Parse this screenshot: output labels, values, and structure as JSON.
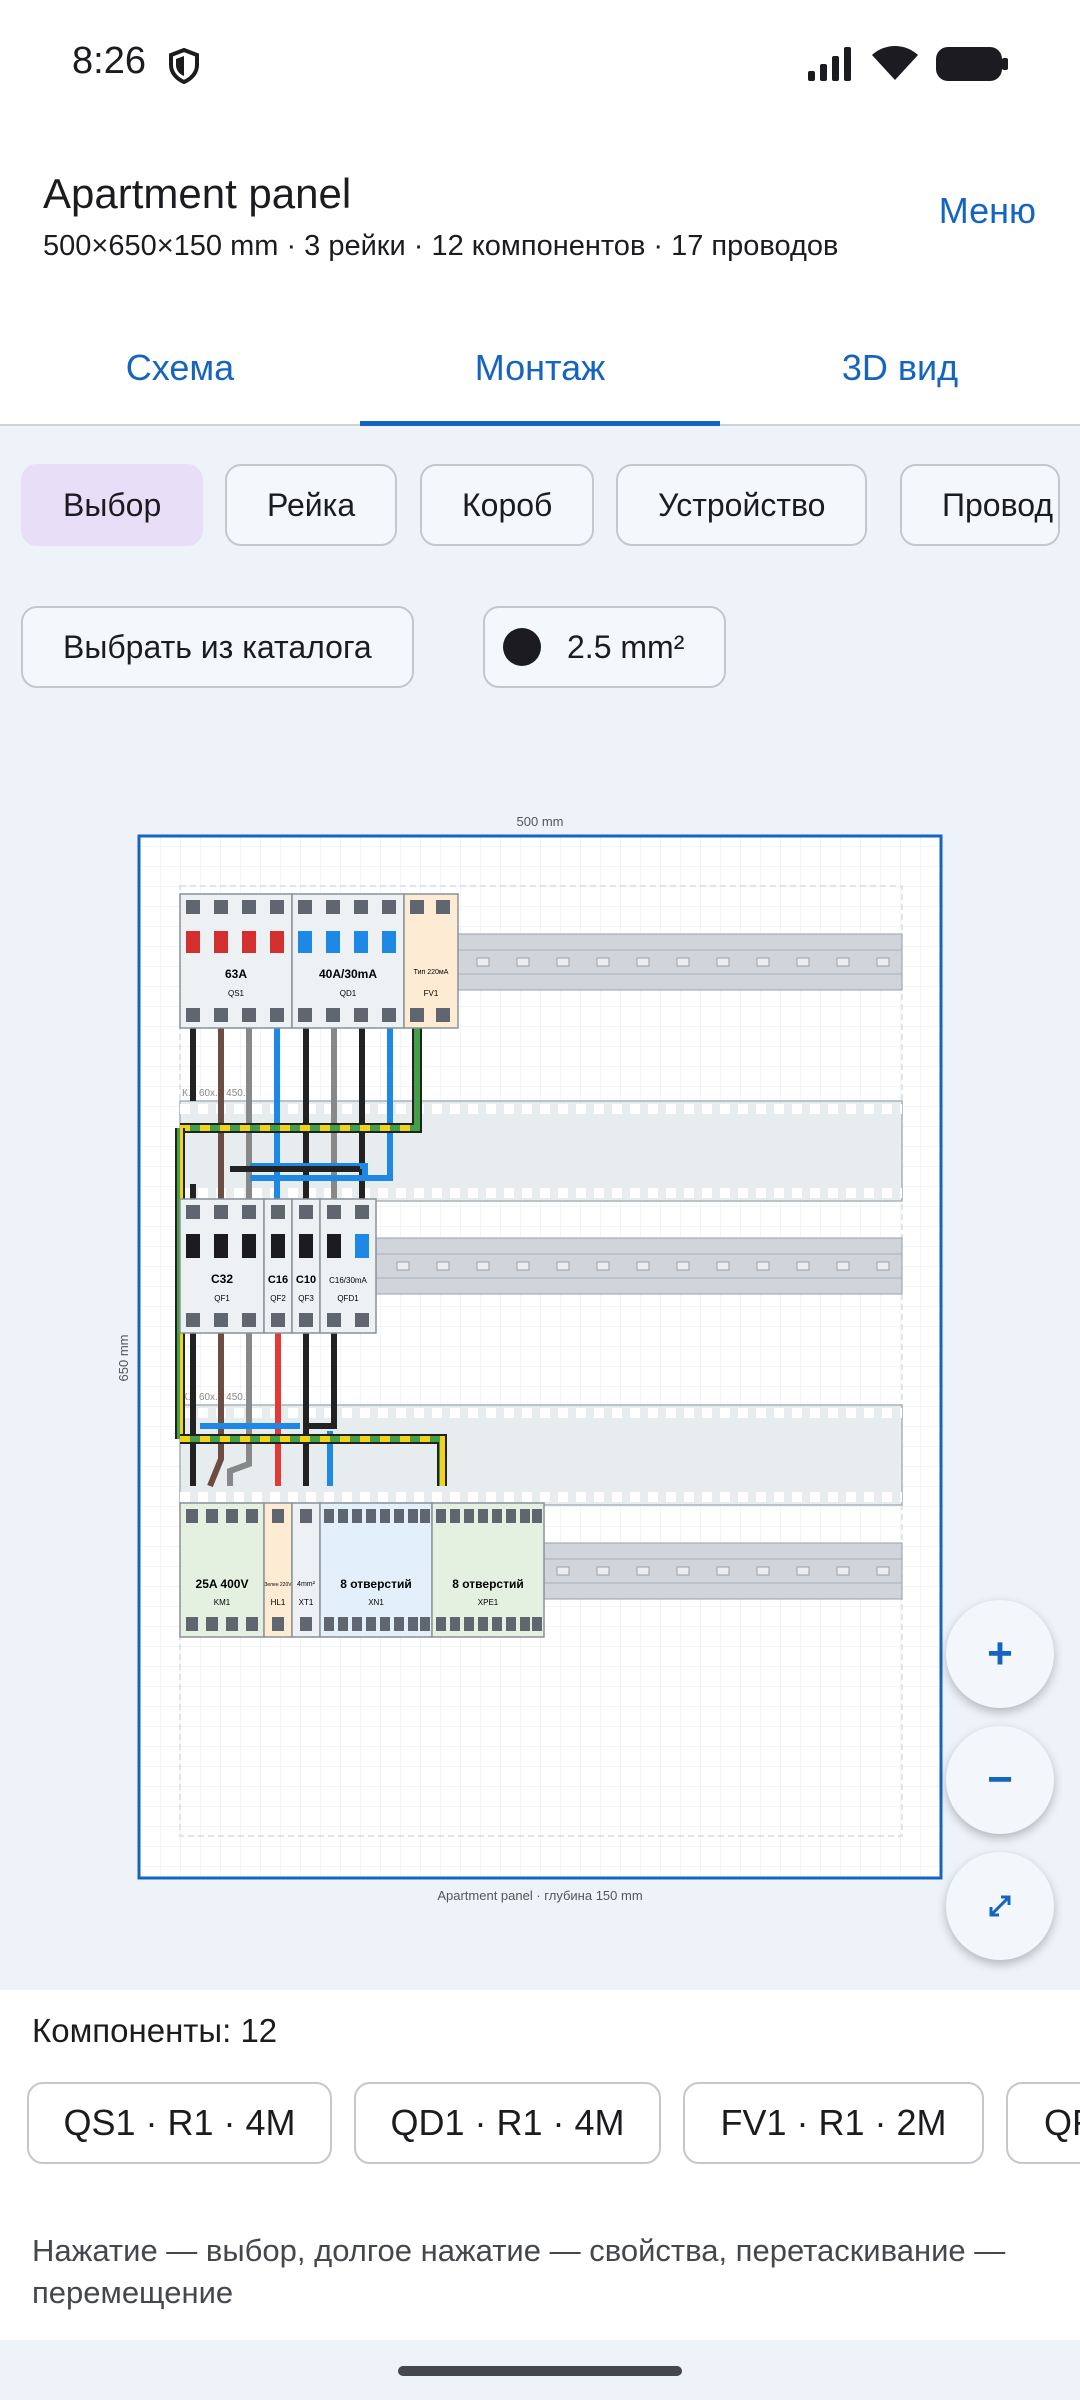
{
  "status": {
    "time": "8:26"
  },
  "header": {
    "title": "Apartment panel",
    "subtitle": "500×650×150 mm · 3 рейки · 12 компонентов · 17 проводов",
    "menu_label": "Меню"
  },
  "tabs": [
    {
      "label": "Схема",
      "active": false
    },
    {
      "label": "Монтаж",
      "active": true
    },
    {
      "label": "3D вид",
      "active": false
    }
  ],
  "tools": {
    "modes": [
      "Выбор",
      "Рейка",
      "Короб",
      "Устройство",
      "Провод"
    ],
    "selected_mode": "Выбор",
    "catalog_label": "Выбрать из каталога",
    "wire_size_label": "2.5 mm²"
  },
  "drawing": {
    "width_label": "500 mm",
    "height_label": "650 mm",
    "caption": "Apartment panel · глубина 150 mm",
    "duct_label": "К... 60х... 450...",
    "devices": [
      {
        "id": "QS1",
        "rating": "63A"
      },
      {
        "id": "QD1",
        "rating": "40A/30mA"
      },
      {
        "id": "FV1",
        "rating": "Тип 220мА"
      },
      {
        "id": "QF1",
        "rating": "C32"
      },
      {
        "id": "QF2",
        "rating": "C16"
      },
      {
        "id": "QF3",
        "rating": "C10"
      },
      {
        "id": "QFD1",
        "rating": "C16/30mA"
      },
      {
        "id": "KM1",
        "rating": "25A 400V"
      },
      {
        "id": "HL1",
        "rating": "Зелен 220V"
      },
      {
        "id": "XT1",
        "rating": "4mm²"
      },
      {
        "id": "XN1",
        "rating": "8 отверстий"
      },
      {
        "id": "XPE1",
        "rating": "8 отверстий"
      }
    ]
  },
  "zoom": {
    "in_label": "+",
    "out_label": "−"
  },
  "components": {
    "count_label": "Компоненты: 12",
    "chips": [
      "QS1 · R1 · 4M",
      "QD1 · R1 · 4M",
      "FV1 · R1 · 2M",
      "QF"
    ]
  },
  "hint": "Нажатие — выбор, долгое нажатие — свойства, перетаскивание — перемещение",
  "colors": {
    "accent": "#1565c0",
    "selected_chip": "#e8def8",
    "canvas_bg": "#eef3f9"
  }
}
